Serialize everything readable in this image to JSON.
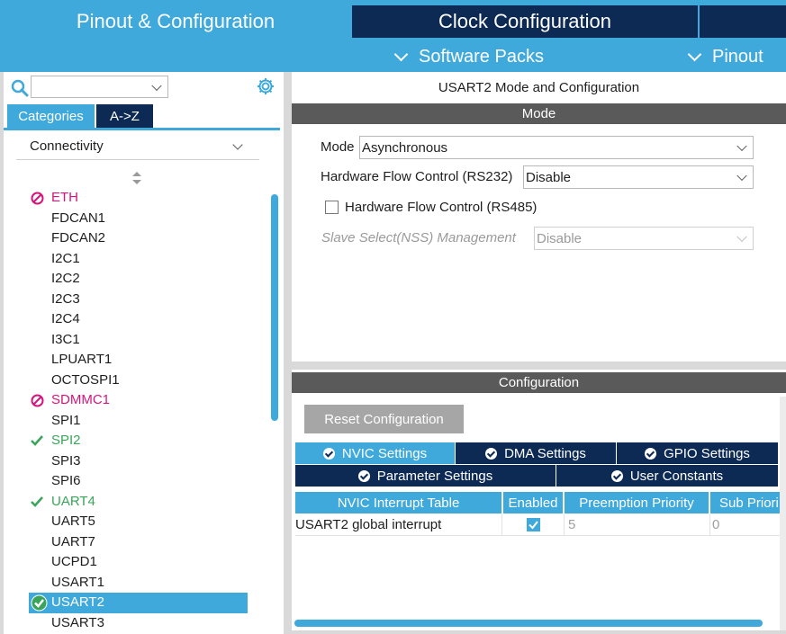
{
  "tabs": {
    "pinout_config": "Pinout & Configuration",
    "clock_config": "Clock Configuration"
  },
  "subnav": {
    "software_packs": "Software Packs",
    "pinout": "Pinout"
  },
  "sidebar": {
    "search_value": "",
    "tab_categories": "Categories",
    "tab_az": "A->Z",
    "category": "Connectivity",
    "items": [
      {
        "label": "ETH",
        "status": "disabled"
      },
      {
        "label": "FDCAN1",
        "status": "none"
      },
      {
        "label": "FDCAN2",
        "status": "none"
      },
      {
        "label": "I2C1",
        "status": "none"
      },
      {
        "label": "I2C2",
        "status": "none"
      },
      {
        "label": "I2C3",
        "status": "none"
      },
      {
        "label": "I2C4",
        "status": "none"
      },
      {
        "label": "I3C1",
        "status": "none"
      },
      {
        "label": "LPUART1",
        "status": "none"
      },
      {
        "label": "OCTOSPI1",
        "status": "none"
      },
      {
        "label": "SDMMC1",
        "status": "disabled"
      },
      {
        "label": "SPI1",
        "status": "none"
      },
      {
        "label": "SPI2",
        "status": "configured"
      },
      {
        "label": "SPI3",
        "status": "none"
      },
      {
        "label": "SPI6",
        "status": "none"
      },
      {
        "label": "UART4",
        "status": "configured"
      },
      {
        "label": "UART5",
        "status": "none"
      },
      {
        "label": "UART7",
        "status": "none"
      },
      {
        "label": "UCPD1",
        "status": "none"
      },
      {
        "label": "USART1",
        "status": "none"
      },
      {
        "label": "USART2",
        "status": "selected"
      },
      {
        "label": "USART3",
        "status": "none"
      }
    ]
  },
  "main": {
    "title": "USART2 Mode and Configuration",
    "mode_header": "Mode",
    "mode_label": "Mode",
    "mode_value": "Asynchronous",
    "hwflow232_label": "Hardware Flow Control (RS232)",
    "hwflow232_value": "Disable",
    "hwflow485_label": "Hardware Flow Control (RS485)",
    "hwflow485_checked": false,
    "nss_label": "Slave Select(NSS) Management",
    "nss_value": "Disable",
    "config_header": "Configuration",
    "reset_button": "Reset Configuration",
    "settings_tabs": [
      "NVIC Settings",
      "DMA Settings",
      "GPIO Settings",
      "Parameter Settings",
      "User Constants"
    ],
    "table": {
      "columns": [
        "NVIC Interrupt Table",
        "Enabled",
        "Preemption Priority",
        "Sub Priori"
      ],
      "rows": [
        {
          "name": "USART2 global interrupt",
          "enabled": true,
          "preemption": "5",
          "sub": "0"
        }
      ]
    }
  },
  "colors": {
    "accent": "#3fa9dc",
    "dark_tab": "#0d2a55",
    "section_header": "#5a5a5a",
    "disabled": "#d6157a",
    "configured": "#3aa55a"
  }
}
